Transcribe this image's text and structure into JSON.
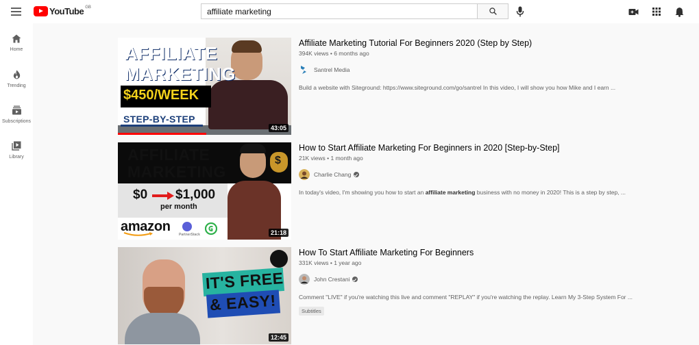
{
  "header": {
    "logo_text": "YouTube",
    "region": "GB",
    "search_value": "affiliate marketing"
  },
  "sidebar": {
    "items": [
      {
        "label": "Home",
        "icon": "home-icon"
      },
      {
        "label": "Trending",
        "icon": "flame-icon"
      },
      {
        "label": "Subscriptions",
        "icon": "subscriptions-icon"
      },
      {
        "label": "Library",
        "icon": "library-icon"
      }
    ]
  },
  "results": [
    {
      "title": "Affiliate Marketing Tutorial For Beginners 2020 (Step by Step)",
      "views": "394K views",
      "age": "6 months ago",
      "channel": "Santrel Media",
      "description": "Build a website with Siteground: https://www.siteground.com/go/santrel In this video, I will show you how Mike and I earn ...",
      "duration": "43:05",
      "watched_fraction": 0.51,
      "thumb": {
        "line1": "AFFILIATE",
        "line2": "MARKETING",
        "line3": "$450/WEEK",
        "line4": "STEP-BY-STEP"
      }
    },
    {
      "title": "How to Start Affiliate Marketing For Beginners in 2020 [Step-by-Step]",
      "views": "21K views",
      "age": "1 month ago",
      "channel": "Charlie Chang",
      "description_before": "In today's video, I'm showing you how to start an ",
      "description_bold": "affiliate marketing",
      "description_after": " business with no money in 2020! This is a step by step, ...",
      "duration": "21:18",
      "thumb": {
        "line1": "AFFILIATE",
        "line2": "MARKETING",
        "from": "$0",
        "to": "$1,000",
        "sub": "per month",
        "brand1": "amazon",
        "brand2": "PartnerStack",
        "dollar": "$"
      }
    },
    {
      "title": "How To Start Affiliate Marketing For Beginners",
      "views": "331K views",
      "age": "1 year ago",
      "channel": "John Crestani",
      "description": "Comment \"LIVE\" if you're watching this live and comment \"REPLAY\" if you're watching the replay. Learn My 3-Step System For ...",
      "badge": "Subtitles",
      "duration": "12:45",
      "thumb": {
        "line1": "IT'S FREE",
        "line2": "& EASY!"
      }
    }
  ],
  "separator": "•"
}
